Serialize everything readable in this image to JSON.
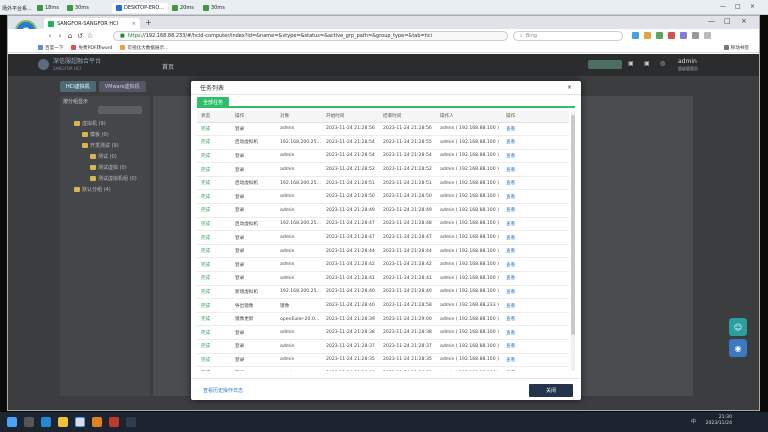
{
  "remote": {
    "tabs": [
      {
        "label": "场外平台系...",
        "ping": ""
      },
      {
        "label": "",
        "ping": "18ms"
      },
      {
        "label": "",
        "ping": "30ms"
      },
      {
        "label": "DESKTOP-ERO...",
        "ping": ""
      },
      {
        "label": "",
        "ping": "20ms"
      },
      {
        "label": "",
        "ping": "30ms"
      }
    ]
  },
  "browser": {
    "logo_label": "浏览",
    "tab_title": "SANGFOR-SANGFOR HCI",
    "url_prefix": "https",
    "url": "://192.168.88.233/#/hcid-computer/index?id=&name=&vtype=&status=&active_grp_path=&group_type=&tab=hci",
    "search_placeholder": "Bing",
    "bookmarks": [
      "百度一下",
      "免费PDF转word",
      "可视化大数据展示..."
    ],
    "bookmarks_right": "移动书签"
  },
  "app": {
    "name": "深信服超融合平台",
    "name_sub": "SANGFOR HCI",
    "home": "首页",
    "user": "admin",
    "user_sub": "超级管理员",
    "tabs": [
      "HCI虚拟机",
      "VMware虚拟机"
    ],
    "tree_header": "按分组显示",
    "tree": [
      {
        "label": "虚拟机 (9)",
        "indent": 0
      },
      {
        "label": "模板 (0)",
        "indent": 1
      },
      {
        "label": "开发测试 (9)",
        "indent": 1
      },
      {
        "label": "测试 (0)",
        "indent": 2
      },
      {
        "label": "测试虚拟 (0)",
        "indent": 2
      },
      {
        "label": "测试虚拟机组 (0)",
        "indent": 2
      },
      {
        "label": "默认分组 (4)",
        "indent": 0
      }
    ]
  },
  "modal": {
    "title": "任务列表",
    "close": "×",
    "tab": "全部任务",
    "columns": [
      "状态",
      "操作",
      "对象",
      "开始时间",
      "结束时间",
      "操作人",
      "操作"
    ],
    "rows": [
      [
        "完成",
        "登录",
        "admin",
        "2023-11-24 21:28:56",
        "2023-11-24 21:28:56",
        "admin ( 192.168.88.100 )",
        "查看"
      ],
      [
        "完成",
        "启动虚拟机",
        "192.168.200.25...",
        "2023-11-24 21:28:54",
        "2023-11-24 21:28:55",
        "admin ( 192.168.88.100 )",
        "查看"
      ],
      [
        "完成",
        "登录",
        "admin",
        "2023-11-24 21:28:54",
        "2023-11-24 21:28:54",
        "admin ( 192.168.88.100 )",
        "查看"
      ],
      [
        "完成",
        "登录",
        "admin",
        "2023-11-24 21:28:52",
        "2023-11-24 21:28:52",
        "admin ( 192.168.88.100 )",
        "查看"
      ],
      [
        "完成",
        "启动虚拟机",
        "192.168.200.25...",
        "2023-11-24 21:28:51",
        "2023-11-24 21:28:51",
        "admin ( 192.168.88.100 )",
        "查看"
      ],
      [
        "完成",
        "登录",
        "admin",
        "2023-11-24 21:28:50",
        "2023-11-24 21:28:50",
        "admin ( 192.168.88.100 )",
        "查看"
      ],
      [
        "完成",
        "登录",
        "admin",
        "2023-11-24 21:28:49",
        "2023-11-24 21:28:49",
        "admin ( 192.168.88.100 )",
        "查看"
      ],
      [
        "完成",
        "启动虚拟机",
        "192.168.200.25...",
        "2023-11-24 21:28:47",
        "2023-11-24 21:28:48",
        "admin ( 192.168.88.100 )",
        "查看"
      ],
      [
        "完成",
        "登录",
        "admin",
        "2023-11-24 21:28:47",
        "2023-11-24 21:28:47",
        "admin ( 192.168.88.100 )",
        "查看"
      ],
      [
        "完成",
        "登录",
        "admin",
        "2023-11-24 21:28:44",
        "2023-11-24 21:28:44",
        "admin ( 192.168.88.100 )",
        "查看"
      ],
      [
        "完成",
        "登录",
        "admin",
        "2023-11-24 21:28:42",
        "2023-11-24 21:28:42",
        "admin ( 192.168.88.100 )",
        "查看"
      ],
      [
        "完成",
        "登录",
        "admin",
        "2023-11-24 21:28:41",
        "2023-11-24 21:28:41",
        "admin ( 192.168.88.100 )",
        "查看"
      ],
      [
        "完成",
        "新增虚拟机",
        "192.168.200.25...",
        "2023-11-24 21:28:40",
        "2023-11-24 21:28:40",
        "admin ( 192.168.88.100 )",
        "查看"
      ],
      [
        "完成",
        "导出镜像",
        "镜像",
        "2023-11-24 21:28:40",
        "2023-11-24 21:28:58",
        "admin ( 192.168.88.233 )",
        "查看"
      ],
      [
        "完成",
        "镜像更新",
        "openEuler-20.0...",
        "2023-11-24 21:28:39",
        "2023-11-24 21:29:00",
        "admin ( 192.168.88.100 )",
        "查看"
      ],
      [
        "完成",
        "登录",
        "admin",
        "2023-11-24 21:28:38",
        "2023-11-24 21:28:38",
        "admin ( 192.168.88.100 )",
        "查看"
      ],
      [
        "完成",
        "登录",
        "admin",
        "2023-11-24 21:28:37",
        "2023-11-24 21:28:37",
        "admin ( 192.168.88.100 )",
        "查看"
      ],
      [
        "完成",
        "登录",
        "admin",
        "2023-11-24 21:28:35",
        "2023-11-24 21:28:35",
        "admin ( 192.168.88.100 )",
        "查看"
      ],
      [
        "完成",
        "登录",
        "admin",
        "2023-11-24 21:28:33",
        "2023-11-24 21:28:33",
        "admin ( 192.168.88.100 )",
        "查看"
      ],
      [
        "完成",
        "导入镜像",
        "镜像",
        "2023-11-24 21:28:31",
        "2023-11-24 21:28:33",
        "admin ( 192.168.88.233 )",
        "查看"
      ],
      [
        "完成",
        "镜像部署",
        "openEuler-20.0...",
        "2023-11-24 21:28:30",
        "2023-11-24 21:28:42",
        "admin ( 192.168.88.100 )",
        "查看"
      ]
    ],
    "view_all": "查看历史操作日志",
    "close_button": "关闭"
  },
  "taskbar": {
    "time": "21:30",
    "date": "2023/11/24",
    "ime": "中"
  },
  "colors": {
    "accent_green": "#2fbf6a",
    "status_green": "#2ea35c",
    "link_blue": "#2b77c9",
    "dark_button": "#24334a"
  }
}
